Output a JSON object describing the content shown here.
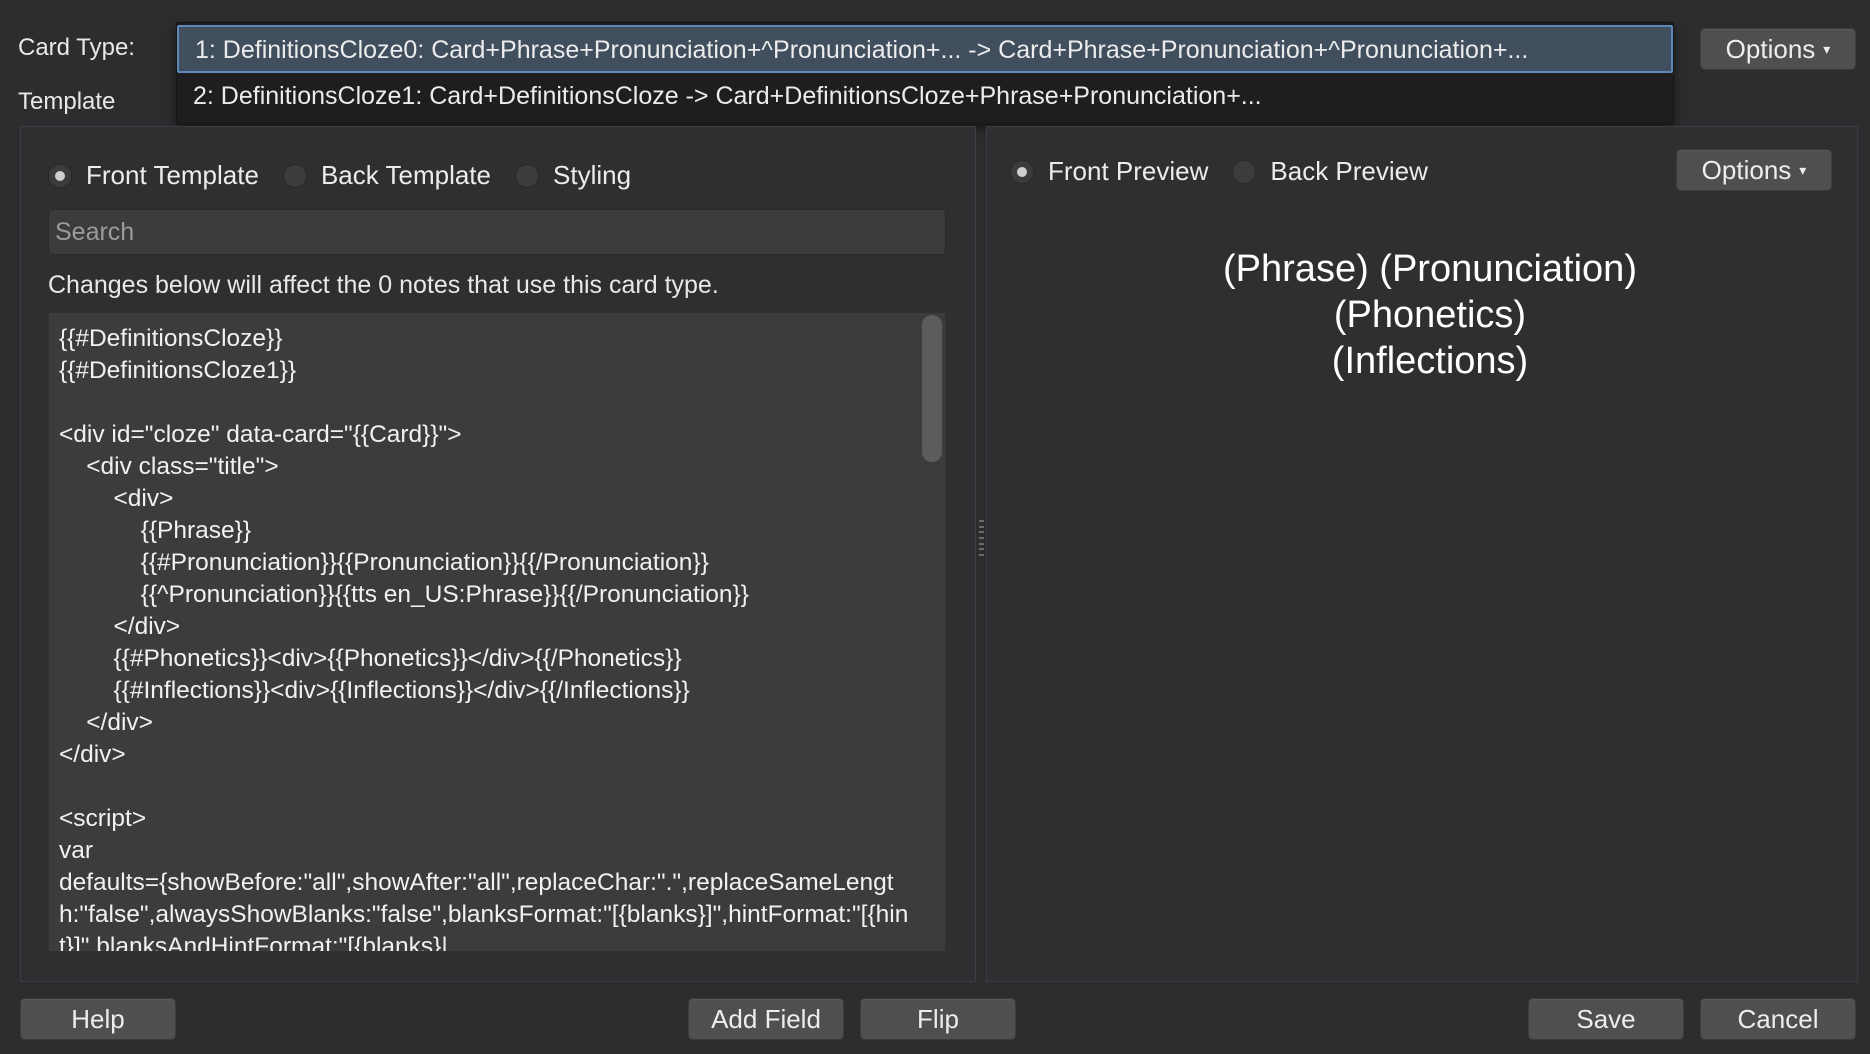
{
  "card_type": {
    "label": "Card Type:",
    "options": [
      "1: DefinitionsCloze0: Card+Phrase+Pronunciation+^Pronunciation+... -> Card+Phrase+Pronunciation+^Pronunciation+...",
      "2: DefinitionsCloze1: Card+DefinitionsCloze -> Card+DefinitionsCloze+Phrase+Pronunciation+..."
    ],
    "selected_index": 0
  },
  "template_label": "Template",
  "top_options_button": "Options",
  "left_panel": {
    "tabs": [
      {
        "label": "Front Template",
        "checked": true
      },
      {
        "label": "Back Template",
        "checked": false
      },
      {
        "label": "Styling",
        "checked": false
      }
    ],
    "search_placeholder": "Search",
    "info": "Changes below will affect the 0 notes that use this card type.",
    "code": "{{#DefinitionsCloze}}\n{{#DefinitionsCloze1}}\n\n<div id=\"cloze\" data-card=\"{{Card}}\">\n    <div class=\"title\">\n        <div>\n            {{Phrase}}\n            {{#Pronunciation}}{{Pronunciation}}{{/Pronunciation}}\n            {{^Pronunciation}}{{tts en_US:Phrase}}{{/Pronunciation}}\n        </div>\n        {{#Phonetics}}<div>{{Phonetics}}</div>{{/Phonetics}}\n        {{#Inflections}}<div>{{Inflections}}</div>{{/Inflections}}\n    </div>\n</div>\n\n<script>\nvar\ndefaults={showBefore:\"all\",showAfter:\"all\",replaceChar:\".\",replaceSameLength:\"false\",alwaysShowBlanks:\"false\",blanksFormat:\"[{blanks}]\",hintFormat:\"[{hint}]\",blanksAndHintFormat:\"[{blanks}|"
  },
  "right_panel": {
    "tabs": [
      {
        "label": "Front Preview",
        "checked": true
      },
      {
        "label": "Back Preview",
        "checked": false
      }
    ],
    "options_button": "Options",
    "preview_lines": [
      "(Phrase) (Pronunciation)",
      "(Phonetics)",
      "(Inflections)"
    ]
  },
  "bottom_buttons": {
    "help": "Help",
    "add_field": "Add Field",
    "flip": "Flip",
    "save": "Save",
    "cancel": "Cancel"
  },
  "icons": {
    "dropdown_caret": "caret-down-icon",
    "splitter_handle": "drag-handle-icon"
  },
  "colors": {
    "background": "#2c2d2f",
    "selection_bg": "#404e5e",
    "selection_border": "#5d88b8",
    "button_bg": "#4e4f51"
  }
}
